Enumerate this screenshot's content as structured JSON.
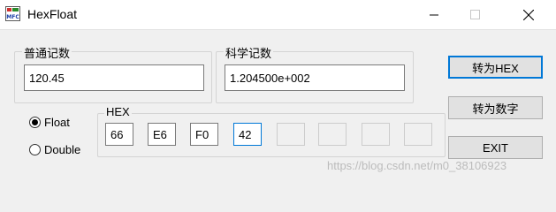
{
  "window": {
    "title": "HexFloat",
    "icon": "mfc-app-icon"
  },
  "normal": {
    "label": "普通记数",
    "value": "120.45"
  },
  "scientific": {
    "label": "科学记数",
    "value": "1.204500e+002"
  },
  "buttons": {
    "to_hex": "转为HEX",
    "to_number": "转为数字",
    "exit": "EXIT"
  },
  "type": {
    "float_label": "Float",
    "double_label": "Double",
    "selected": "Float"
  },
  "hex": {
    "label": "HEX",
    "bytes": [
      "66",
      "E6",
      "F0",
      "42",
      "",
      "",
      "",
      ""
    ]
  },
  "watermark": "https://blog.csdn.net/m0_38106923"
}
